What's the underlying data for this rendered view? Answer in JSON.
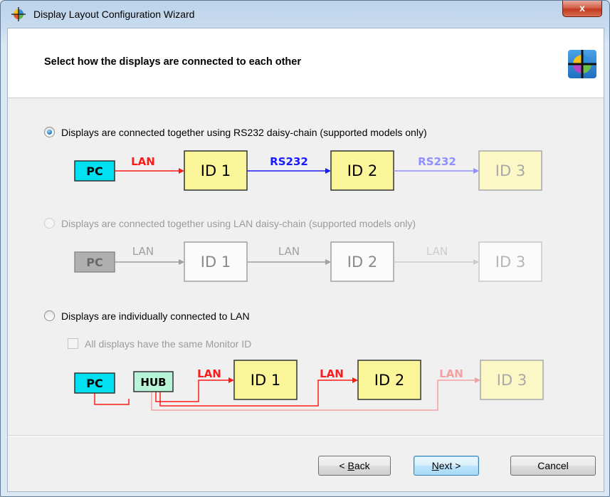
{
  "window": {
    "title": "Display Layout Configuration Wizard",
    "close_label": "x"
  },
  "header": {
    "title": "Select how the displays are connected to each other"
  },
  "options": [
    {
      "label": "Displays are connected together using RS232 daisy-chain (supported models only)",
      "selected": true,
      "enabled": true,
      "diagram": {
        "pc": "PC",
        "links": [
          "LAN",
          "RS232",
          "RS232"
        ],
        "displays": [
          "ID 1",
          "ID 2",
          "ID 3"
        ]
      }
    },
    {
      "label": "Displays are connected together using LAN daisy-chain (supported models only)",
      "selected": false,
      "enabled": false,
      "diagram": {
        "pc": "PC",
        "links": [
          "LAN",
          "LAN",
          "LAN"
        ],
        "displays": [
          "ID 1",
          "ID 2",
          "ID 3"
        ]
      }
    },
    {
      "label": "Displays are individually connected to LAN",
      "selected": false,
      "enabled": true,
      "checkbox": {
        "label": "All displays have the same Monitor ID",
        "checked": false,
        "enabled": false
      },
      "diagram": {
        "pc": "PC",
        "hub": "HUB",
        "links": [
          "LAN",
          "LAN",
          "LAN"
        ],
        "displays": [
          "ID 1",
          "ID 2",
          "ID 3"
        ]
      }
    }
  ],
  "buttons": {
    "back": {
      "prefix": "< ",
      "mnemonic": "B",
      "rest": "ack"
    },
    "next": {
      "mnemonic": "N",
      "rest": "ext >"
    },
    "cancel": "Cancel"
  },
  "colors": {
    "pc_box": "#00e0f0",
    "hub_box": "#b8f5d8",
    "display_box": "#fbf59a",
    "lan_link": "#ff1a1a",
    "rs232_link": "#1a1aff",
    "disabled": "#a0a0a0"
  }
}
